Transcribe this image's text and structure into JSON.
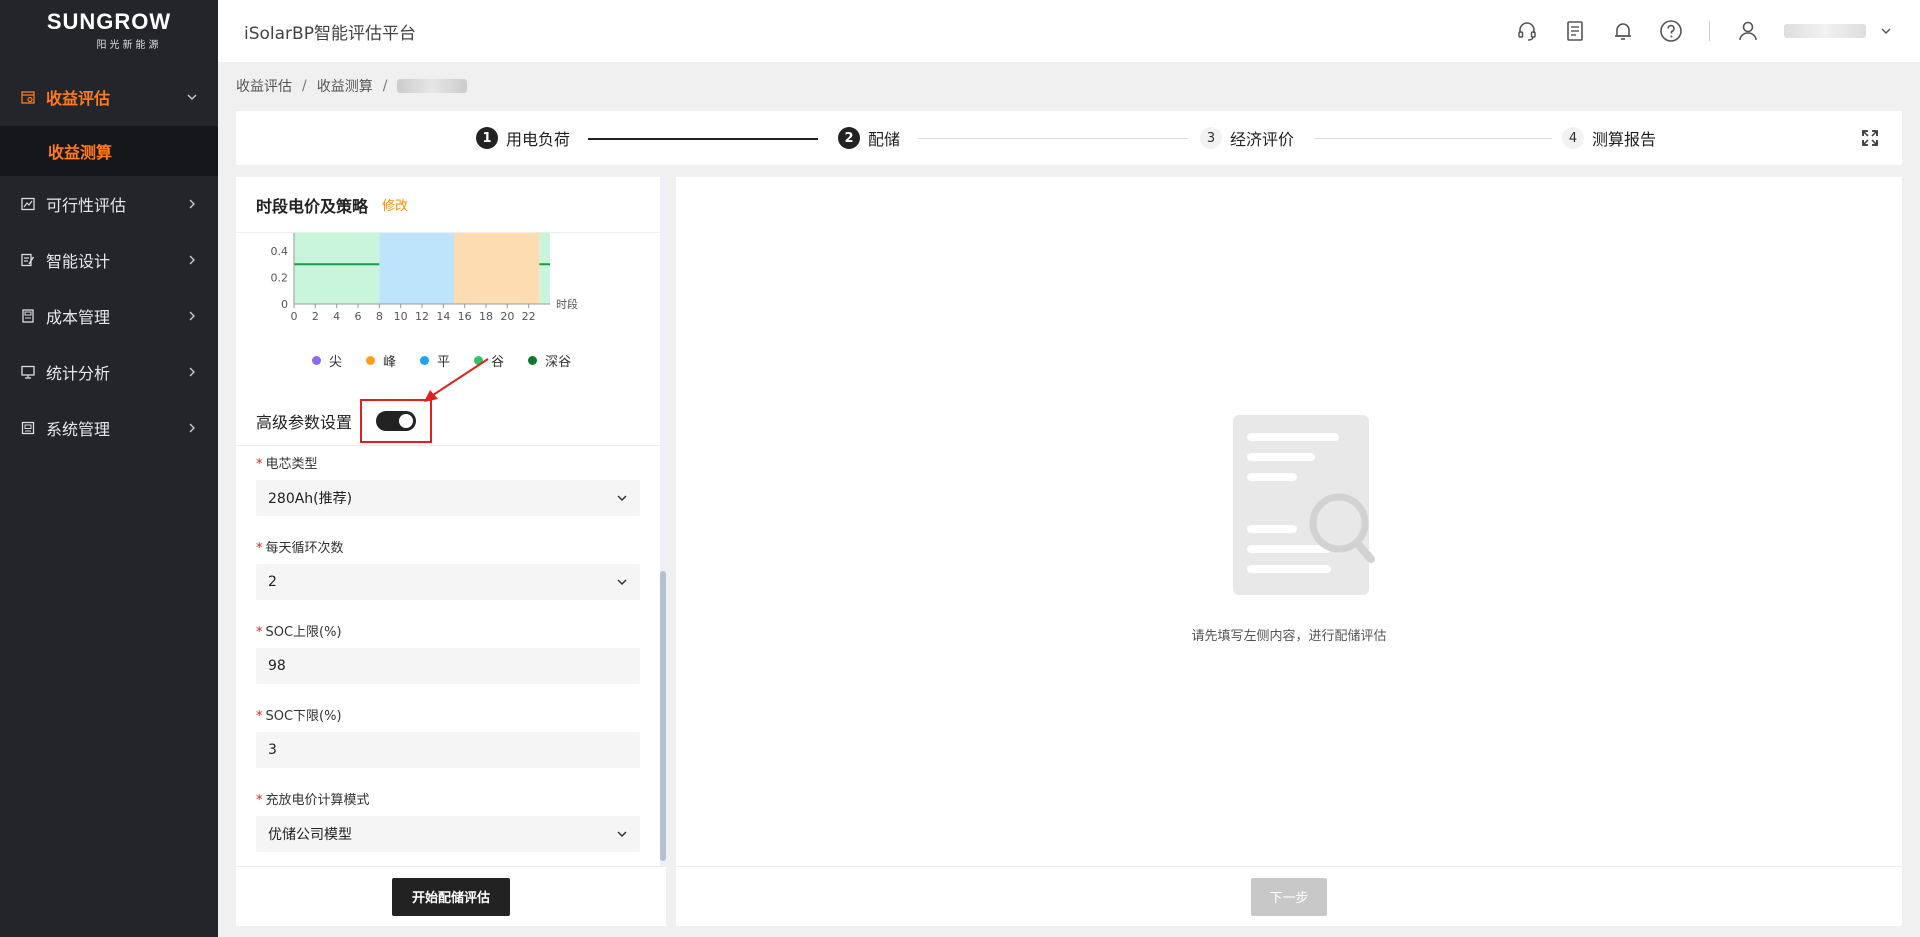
{
  "logo": {
    "main": "SUNGROW",
    "sub": "阳光新能源"
  },
  "header": {
    "title": "iSolarBP智能评估平台"
  },
  "sidebar": {
    "items": [
      {
        "label": "收益评估",
        "active": true,
        "icon": "revenue-icon"
      },
      {
        "label": "可行性评估",
        "icon": "chart-icon"
      },
      {
        "label": "智能设计",
        "icon": "design-icon"
      },
      {
        "label": "成本管理",
        "icon": "cost-icon"
      },
      {
        "label": "统计分析",
        "icon": "monitor-icon"
      },
      {
        "label": "系统管理",
        "icon": "settings-icon"
      }
    ],
    "submenu": {
      "label": "收益测算"
    }
  },
  "breadcrumb": {
    "level1": "收益评估",
    "level2": "收益测算",
    "sep": "/"
  },
  "steps": [
    {
      "num": "1",
      "label": "用电负荷",
      "state": "done"
    },
    {
      "num": "2",
      "label": "配储",
      "state": "current"
    },
    {
      "num": "3",
      "label": "经济评价",
      "state": "todo"
    },
    {
      "num": "4",
      "label": "测算报告",
      "state": "todo"
    }
  ],
  "left_panel": {
    "title": "时段电价及策略",
    "edit": "修改",
    "advanced_label": "高级参数设置",
    "advanced_on": true,
    "fields": [
      {
        "label": "电芯类型",
        "value": "280Ah(推荐)",
        "type": "select"
      },
      {
        "label": "每天循环次数",
        "value": "2",
        "type": "select"
      },
      {
        "label": "SOC上限(%)",
        "value": "98",
        "type": "input"
      },
      {
        "label": "SOC下限(%)",
        "value": "3",
        "type": "input"
      },
      {
        "label": "充放电价计算模式",
        "value": "优储公司模型",
        "type": "select"
      }
    ],
    "submit": "开始配储评估"
  },
  "right_panel": {
    "empty_text": "请先填写左侧内容，进行配储评估",
    "next": "下一步"
  },
  "chart_data": {
    "type": "area",
    "xlabel": "时段",
    "x_ticks": [
      "0",
      "2",
      "4",
      "6",
      "8",
      "10",
      "12",
      "14",
      "16",
      "18",
      "20",
      "22"
    ],
    "y_ticks": [
      "0",
      "0.2",
      "0.4"
    ],
    "ylim": [
      0,
      0.4
    ],
    "xlim": [
      0,
      24
    ],
    "bands": [
      {
        "from": 0,
        "to": 8,
        "type": "谷",
        "color": "#c9f5dc"
      },
      {
        "from": 8,
        "to": 15,
        "type": "平",
        "color": "#bde4fb"
      },
      {
        "from": 15,
        "to": 23,
        "type": "峰",
        "color": "#fddcb1"
      },
      {
        "from": 23,
        "to": 24,
        "type": "谷",
        "color": "#c9f5dc"
      }
    ],
    "series": [
      {
        "x": [
          0,
          8
        ],
        "y": [
          0.3,
          0.3
        ],
        "color": "#1a9b4a"
      },
      {
        "x": [
          23,
          24
        ],
        "y": [
          0.3,
          0.3
        ],
        "color": "#1a9b4a"
      }
    ],
    "legend": [
      {
        "name": "尖",
        "color": "#8a6cf0"
      },
      {
        "name": "峰",
        "color": "#ff9e1b"
      },
      {
        "name": "平",
        "color": "#1aa7ec"
      },
      {
        "name": "谷",
        "color": "#2fc46b"
      },
      {
        "name": "深谷",
        "color": "#0f7a2e"
      }
    ]
  }
}
